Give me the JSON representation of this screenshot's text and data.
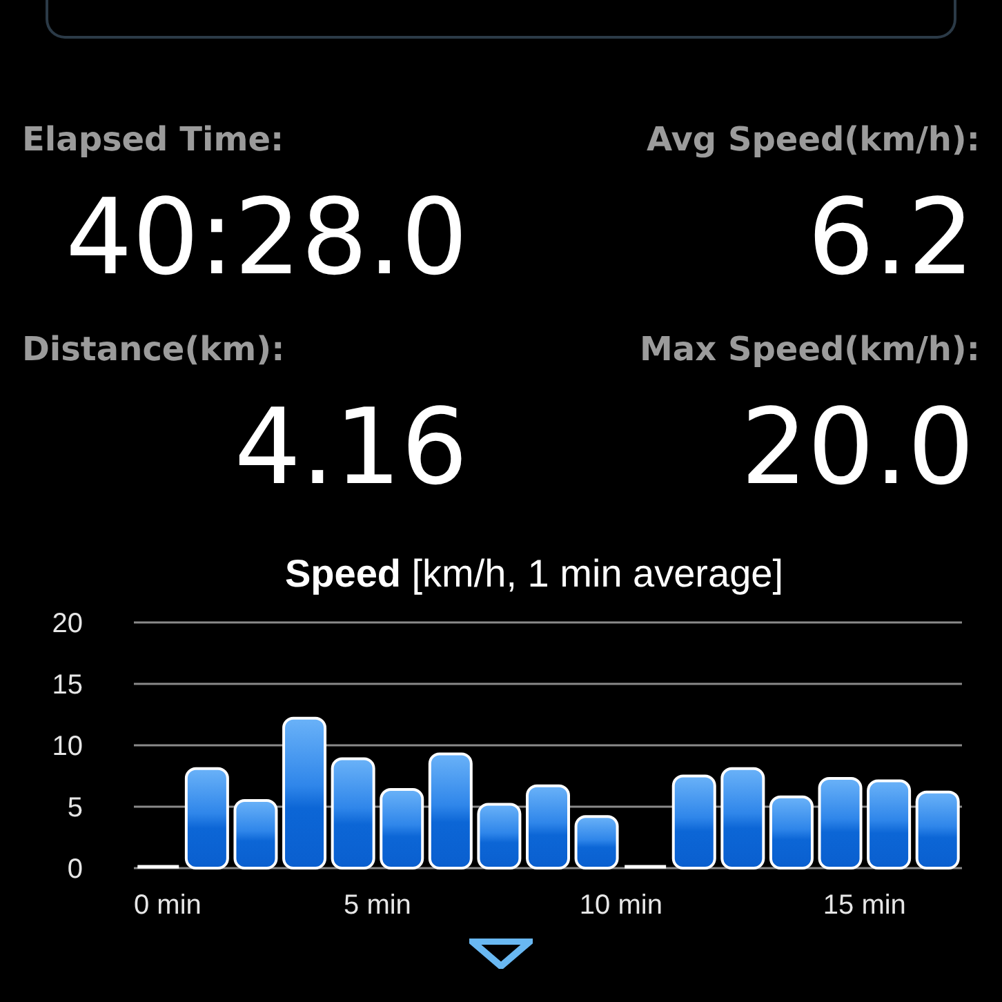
{
  "stats": [
    {
      "label": "Elapsed Time:",
      "value": "40:28.0"
    },
    {
      "label": "Avg Speed(km/h):",
      "value": "6.2"
    },
    {
      "label": "Distance(km):",
      "value": "4.16"
    },
    {
      "label": "Max Speed(km/h):",
      "value": "20.0"
    }
  ],
  "chart": {
    "title": "**Speed** [km/h, 1 min average]",
    "chart_data": {
      "type": "bar",
      "x": [
        0.5,
        1.5,
        2.5,
        3.5,
        4.5,
        5.5,
        6.5,
        7.5,
        8.5,
        9.5,
        10.5,
        11.5,
        12.5,
        13.5,
        14.5,
        15.5,
        16.5
      ],
      "values": [
        0,
        8.1,
        5.5,
        12.2,
        8.9,
        6.4,
        9.3,
        5.2,
        6.7,
        4.2,
        0,
        7.5,
        8.1,
        5.8,
        7.3,
        7.1,
        6.2
      ],
      "xlim": [
        0,
        17
      ],
      "grid": true,
      "ylim": [
        0,
        20
      ],
      "yticks": [
        0,
        5,
        10,
        15,
        20
      ],
      "xticks": [
        {
          "value": 0,
          "label": "0 min"
        },
        {
          "value": 5,
          "label": "5 min"
        },
        {
          "value": 10,
          "label": "10 min"
        },
        {
          "value": 15,
          "label": "15 min"
        }
      ]
    }
  }
}
